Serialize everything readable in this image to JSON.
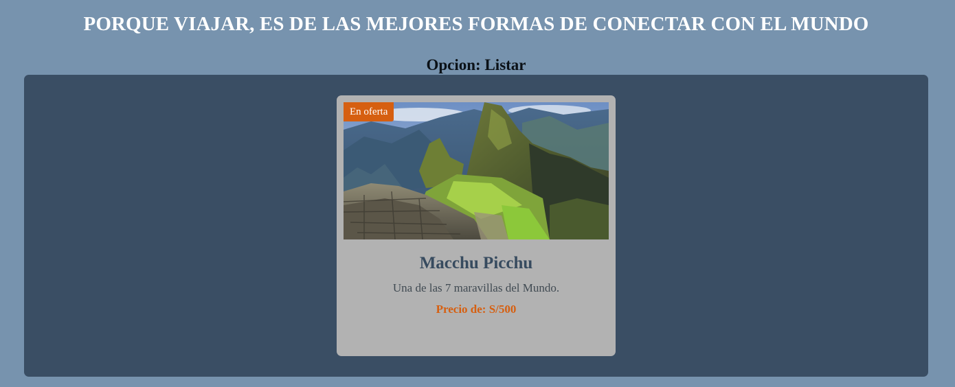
{
  "header": {
    "title": "PORQUE VIAJAR, ES DE LAS MEJORES FORMAS DE CONECTAR CON EL MUNDO",
    "option": "Opcion: Listar"
  },
  "colors": {
    "page_background": "#7793ae",
    "panel_background": "#3a4e64",
    "card_background": "#b2b2b2",
    "accent": "#d65f10",
    "card_title": "#374b5f"
  },
  "cards": [
    {
      "badge": "En oferta",
      "image": "mountain-ruins-photo",
      "title": "Macchu Picchu",
      "description": "Una de las 7 maravillas del Mundo.",
      "price": "Precio de: S/500"
    }
  ]
}
